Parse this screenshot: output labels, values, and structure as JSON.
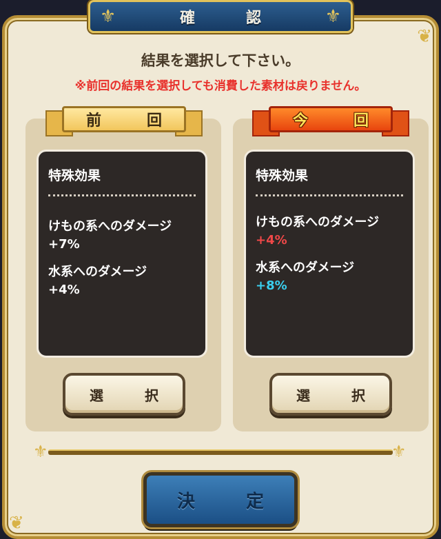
{
  "dialog": {
    "title": "確　認",
    "instruction": "結果を選択して下さい。",
    "warning": "※前回の結果を選択しても消費した素材は戻りません。"
  },
  "previous": {
    "ribbon": "前　回",
    "heading": "特殊効果",
    "effects": [
      {
        "name": "けもの系へのダメージ",
        "value": "+7%"
      },
      {
        "name": "水系へのダメージ",
        "value": "+4%"
      }
    ],
    "select_label": "選　択"
  },
  "current": {
    "ribbon": "今　回",
    "heading": "特殊効果",
    "effects": [
      {
        "name": "けもの系へのダメージ",
        "value": "+4%"
      },
      {
        "name": "水系へのダメージ",
        "value": "+8%"
      }
    ],
    "select_label": "選　択"
  },
  "confirm_label": "決　定",
  "colors": {
    "value_default": "#ffffff",
    "value_decrease": "#f04848",
    "value_increase": "#3ad0f0",
    "warning": "#e8312c"
  },
  "icons": {
    "title_left": "fleur-de-lis-icon",
    "title_right": "fleur-de-lis-icon",
    "divider_left": "fleur-de-lis-icon",
    "divider_right": "fleur-de-lis-icon"
  }
}
